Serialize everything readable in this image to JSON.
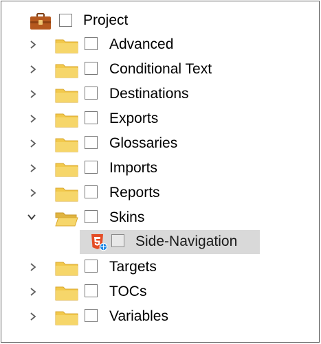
{
  "tree": {
    "root": {
      "label": "Project",
      "icon": "briefcase-icon"
    },
    "items": [
      {
        "label": "Advanced",
        "expanded": false
      },
      {
        "label": "Conditional Text",
        "expanded": false
      },
      {
        "label": "Destinations",
        "expanded": false
      },
      {
        "label": "Exports",
        "expanded": false
      },
      {
        "label": "Glossaries",
        "expanded": false
      },
      {
        "label": "Imports",
        "expanded": false
      },
      {
        "label": "Reports",
        "expanded": false
      },
      {
        "label": "Skins",
        "expanded": true,
        "children": [
          {
            "label": "Side-Navigation",
            "icon": "html5-skin-icon",
            "selected": true
          }
        ]
      },
      {
        "label": "Targets",
        "expanded": false
      },
      {
        "label": "TOCs",
        "expanded": false
      },
      {
        "label": "Variables",
        "expanded": false
      }
    ]
  },
  "colors": {
    "folder_fill": "#f2c94c",
    "folder_edge": "#d9a830",
    "selection_bg": "#d9d9d9",
    "html5_orange": "#e44d26",
    "globe_blue": "#1e88e5"
  }
}
